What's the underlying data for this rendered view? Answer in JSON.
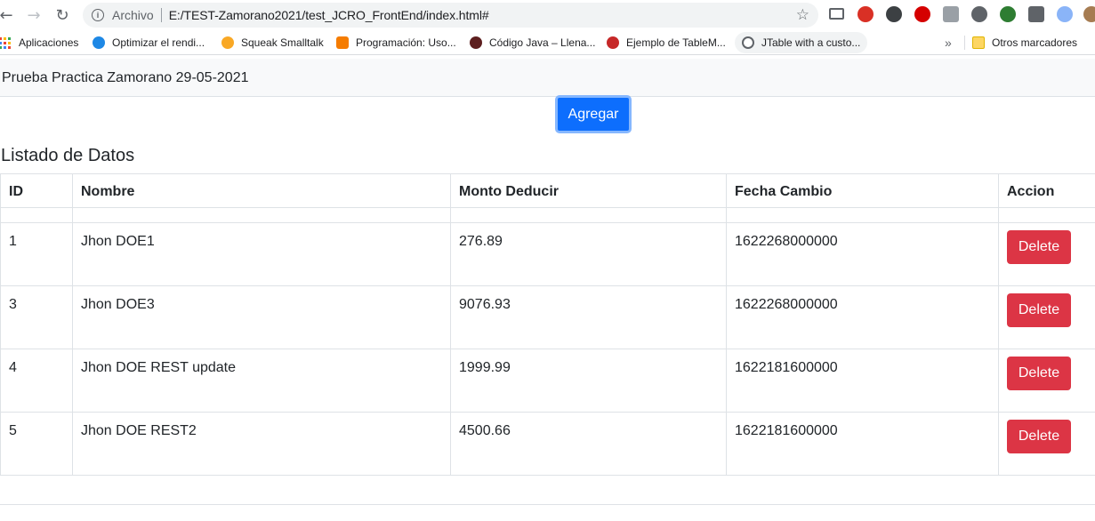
{
  "browser": {
    "scheme_label": "Archivo",
    "url": "E:/TEST-Zamorano2021/test_JCRO_FrontEnd/index.html#",
    "bookmarks": [
      "Aplicaciones",
      "Optimizar el rendi...",
      "Squeak Smalltalk",
      "Programación: Uso...",
      "Código Java – Llena...",
      "Ejemplo de TableM...",
      "JTable with a custo..."
    ],
    "more_bookmarks": "»",
    "other_bookmarks": "Otros marcadores"
  },
  "app": {
    "brand": "Prueba Practica Zamorano 29-05-2021",
    "add_label": "Agregar",
    "list_title": "Listado de Datos"
  },
  "table": {
    "headers": [
      "ID",
      "Nombre",
      "Monto Deducir",
      "Fecha Cambio",
      "Accion"
    ],
    "rows": [
      {
        "id": "1",
        "nombre": "Jhon DOE1",
        "monto": "276.89",
        "fecha": "1622268000000",
        "action": "Delete"
      },
      {
        "id": "3",
        "nombre": "Jhon DOE3",
        "monto": "9076.93",
        "fecha": "1622268000000",
        "action": "Delete"
      },
      {
        "id": "4",
        "nombre": "Jhon DOE REST update",
        "monto": "1999.99",
        "fecha": "1622181600000",
        "action": "Delete"
      },
      {
        "id": "5",
        "nombre": "Jhon DOE REST2",
        "monto": "4500.66",
        "fecha": "1622181600000",
        "action": "Delete"
      }
    ]
  },
  "colors": {
    "primary": "#0d6efd",
    "danger": "#dc3545"
  }
}
